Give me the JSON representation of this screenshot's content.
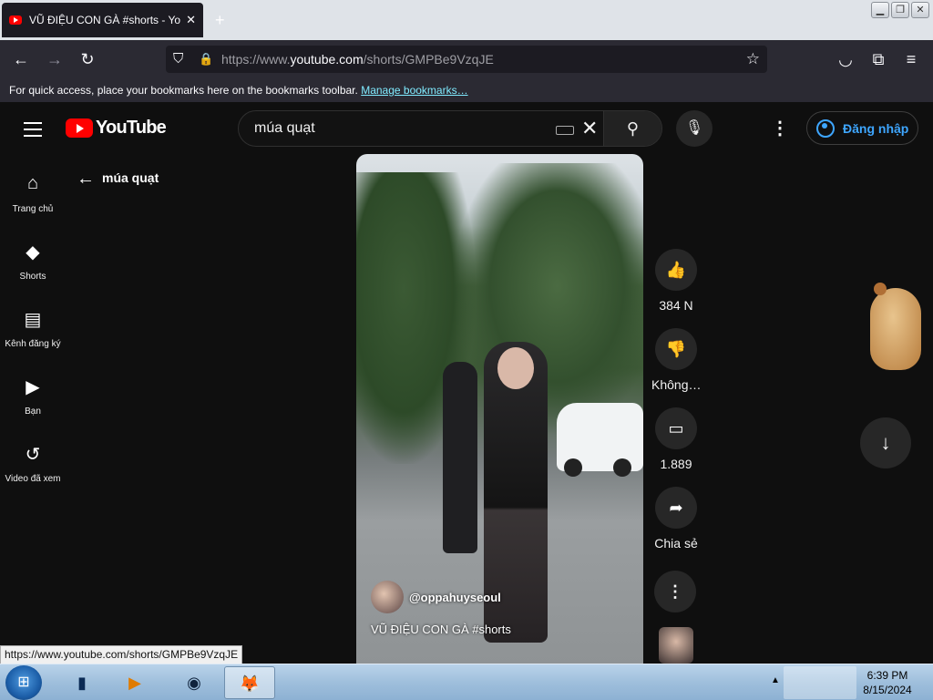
{
  "browser": {
    "tab_title": "VŨ ĐIỆU CON GÀ #shorts - YouTube",
    "tab_close": "✕",
    "new_tab": "+",
    "window_controls": [
      "▁",
      "❐",
      "✕"
    ],
    "back_icon": "←",
    "forward_icon": "→",
    "reload_icon": "↻",
    "url_prefix": "https://www.",
    "url_domain": "youtube.com",
    "url_path": "/shorts/GMPBe9VzqJE",
    "star_icon": "☆",
    "pocket_icon": "◡",
    "extensions_icon": "⧉",
    "menu_icon": "≡",
    "bookmarks_text": "For quick access, place your bookmarks here on the bookmarks toolbar.",
    "bookmarks_link": "Manage bookmarks…",
    "status_url": "https://www.youtube.com/shorts/GMPBe9VzqJE"
  },
  "youtube": {
    "logo_text": "YouTube",
    "search_query": "múa quạt",
    "clear_icon": "✕",
    "search_icon": "⚲",
    "mic_icon": "🎙",
    "more_icon": "⋮",
    "signin_label": "Đăng nhập",
    "sidebar": [
      {
        "icon": "⌂",
        "label": "Trang chủ"
      },
      {
        "icon": "◆",
        "label": "Shorts"
      },
      {
        "icon": "▤",
        "label": "Kênh đăng ký"
      },
      {
        "icon": "▶",
        "label": "Bạn"
      },
      {
        "icon": "↺",
        "label": "Video đã xem"
      }
    ],
    "back_arrow": "←",
    "query_title": "múa quạt",
    "video": {
      "channel": "@oppahuyseoul",
      "title": "VŨ ĐIỆU CON GÀ #shorts"
    },
    "actions": [
      {
        "icon": "👍",
        "count": "384 N"
      },
      {
        "icon": "👎",
        "count": "Không…"
      },
      {
        "icon": "▭",
        "count": "1.889"
      },
      {
        "icon": "➦",
        "count": "Chia sẻ"
      }
    ],
    "action_more": "⋮",
    "down_icon": "↓"
  },
  "taskbar": {
    "start_icon": "⊞",
    "apps": [
      {
        "icon": "▮"
      },
      {
        "icon": "▶"
      },
      {
        "icon": "◉"
      },
      {
        "icon": "🦊"
      }
    ],
    "tray_arrow": "▲",
    "time": "6:39 PM",
    "date": "8/15/2024"
  }
}
